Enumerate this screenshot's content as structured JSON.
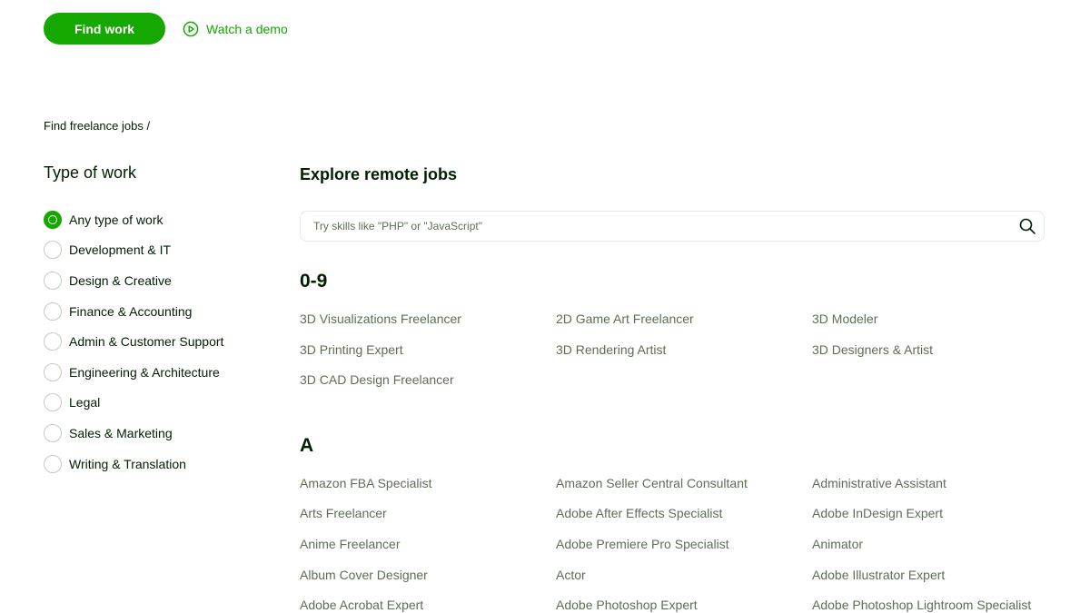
{
  "hero": {
    "find_work_label": "Find work",
    "watch_demo_label": "Watch a demo",
    "accent_color": "#14a800"
  },
  "breadcrumb": {
    "text": "Find freelance jobs /"
  },
  "sidebar": {
    "title": "Type of work",
    "selected": "Any type of work",
    "items": [
      {
        "label": "Any type of work",
        "checked": true
      },
      {
        "label": "Development & IT",
        "checked": false
      },
      {
        "label": "Design & Creative",
        "checked": false
      },
      {
        "label": "Finance & Accounting",
        "checked": false
      },
      {
        "label": "Admin & Customer Support",
        "checked": false
      },
      {
        "label": "Engineering & Architecture",
        "checked": false
      },
      {
        "label": "Legal",
        "checked": false
      },
      {
        "label": "Sales & Marketing",
        "checked": false
      },
      {
        "label": "Writing & Translation",
        "checked": false
      }
    ]
  },
  "main": {
    "title": "Explore remote jobs",
    "search": {
      "placeholder": "Try skills like \"PHP\" or \"JavaScript\"",
      "value": "",
      "icon": "search-icon"
    },
    "sections": [
      {
        "heading": "0-9",
        "jobs": [
          "3D Visualizations Freelancer",
          "2D Game Art Freelancer",
          "3D Modeler",
          "3D Printing Expert",
          "3D Rendering Artist",
          "3D Designers & Artist",
          "3D CAD Design Freelancer"
        ]
      },
      {
        "heading": "A",
        "jobs": [
          "Amazon FBA Specialist",
          "Amazon Seller Central Consultant",
          "Administrative Assistant",
          "Arts Freelancer",
          "Adobe After Effects Specialist",
          "Adobe InDesign Expert",
          "Anime Freelancer",
          "Adobe Premiere Pro Specialist",
          "Animator",
          "Album Cover Designer",
          "Actor",
          "Adobe Illustrator Expert",
          "Adobe Acrobat Expert",
          "Adobe Photoshop Expert",
          "Adobe Photoshop Lightroom Specialist"
        ]
      }
    ]
  }
}
